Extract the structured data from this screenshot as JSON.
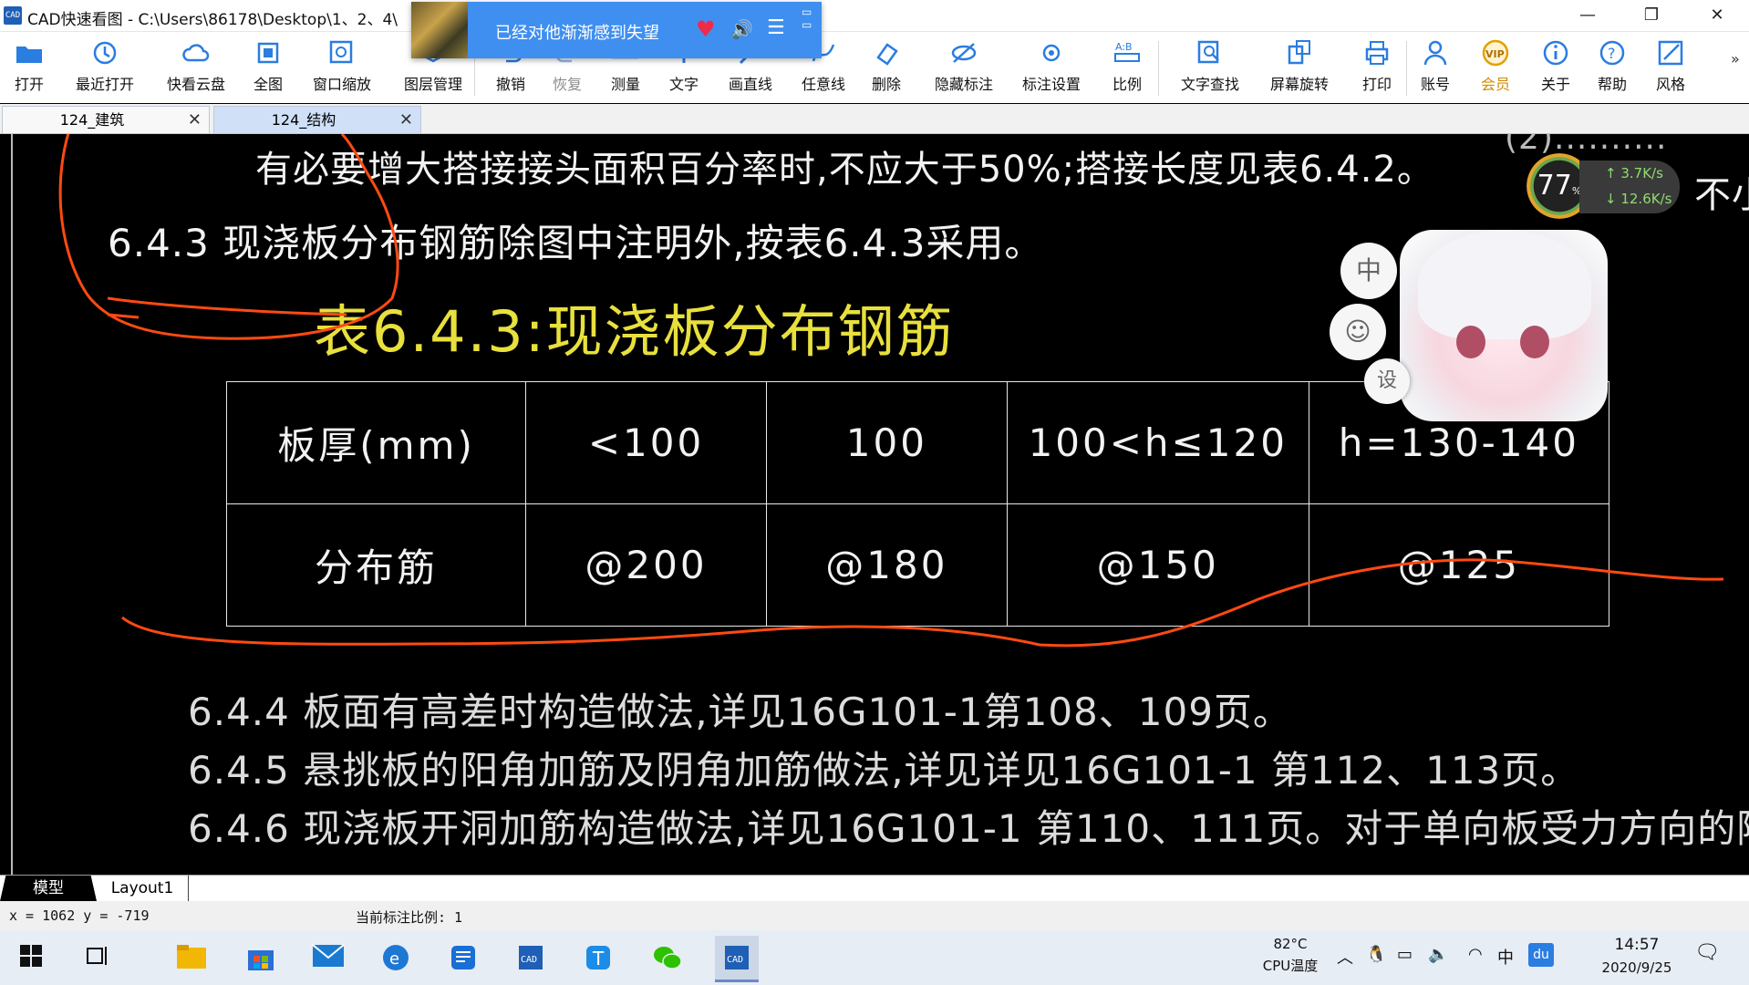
{
  "window": {
    "app_icon": "CAD",
    "title": "CAD快速看图 - C:\\Users\\86178\\Desktop\\1、2、4\\",
    "controls": [
      "minimize-icon",
      "restore-icon",
      "close-icon"
    ]
  },
  "music_popup": {
    "text": "已经对他渐渐感到失望"
  },
  "toolbar": {
    "items": [
      {
        "label": "打开",
        "icon": "folder-open-icon"
      },
      {
        "label": "最近打开",
        "icon": "history-icon"
      },
      {
        "label": "快看云盘",
        "icon": "cloud-icon"
      },
      {
        "label": "全图",
        "icon": "fit-all-icon"
      },
      {
        "label": "窗口缩放",
        "icon": "zoom-window-icon"
      },
      {
        "label": "图层管理",
        "icon": "layers-icon"
      },
      {
        "label": "撤销",
        "icon": "undo-icon"
      },
      {
        "label": "恢复",
        "icon": "redo-icon",
        "disabled": true
      },
      {
        "label": "测量",
        "icon": "measure-icon"
      },
      {
        "label": "文字",
        "icon": "text-icon"
      },
      {
        "label": "画直线",
        "icon": "line-icon"
      },
      {
        "label": "任意线",
        "icon": "freehand-icon"
      },
      {
        "label": "删除",
        "icon": "eraser-icon"
      },
      {
        "label": "隐藏标注",
        "icon": "hide-icon"
      },
      {
        "label": "标注设置",
        "icon": "annotation-settings-icon"
      },
      {
        "label": "比例",
        "icon": "scale-icon"
      },
      {
        "label": "文字查找",
        "icon": "text-search-icon"
      },
      {
        "label": "屏幕旋转",
        "icon": "rotate-icon"
      },
      {
        "label": "打印",
        "icon": "print-icon"
      },
      {
        "label": "账号",
        "icon": "user-icon"
      },
      {
        "label": "会员",
        "icon": "vip-icon"
      },
      {
        "label": "关于",
        "icon": "info-icon"
      },
      {
        "label": "帮助",
        "icon": "help-icon"
      },
      {
        "label": "风格",
        "icon": "style-icon"
      }
    ],
    "vip_badge": "VIP"
  },
  "tabs": [
    {
      "label": "124_建筑",
      "active": false
    },
    {
      "label": "124_结构",
      "active": true
    }
  ],
  "drawing": {
    "line1": "有必要增大搭接接头面积百分率时,不应大于50%;搭接长度见表6.4.2。",
    "line2": "6.4.3  现浇板分布钢筋除图中注明外,按表6.4.3采用。",
    "table_title": "表6.4.3:现浇板分布钢筋",
    "table": {
      "rows": [
        [
          "板厚(mm)",
          "<100",
          "100",
          "100<h≤120",
          "h=130-140"
        ],
        [
          "分布筋",
          "@200",
          "@180",
          "@150",
          "@125"
        ]
      ]
    },
    "line3": "6.4.4  板面有高差时构造做法,详见16G101-1第108、109页。",
    "line4": "6.4.5  悬挑板的阳角加筋及阴角加筋做法,详见详见16G101-1  第112、113页。",
    "line5": "6.4.6  现浇板开洞加筋构造做法,详见16G101-1  第110、111页。对于单向板受力方向的附加钢筋应伸",
    "right_partial_top": "(2)..........",
    "right_partial": "不小"
  },
  "overlays": {
    "perf_percent": "77",
    "perf_unit": "%",
    "upload": "3.7K/s",
    "download": "12.6K/s",
    "bubble_top": "中",
    "bubble_bottom": "设"
  },
  "layout_tabs": [
    "模型",
    "Layout1"
  ],
  "status": {
    "coords": "x = 1062  y = -719",
    "scale": "当前标注比例: 1"
  },
  "taskbar": {
    "cpu_temp": "82°C",
    "cpu_label": "CPU温度",
    "ime": "中",
    "time": "14:57",
    "date": "2020/9/25"
  },
  "colors": {
    "canvas_bg": "#000000",
    "table_title": "#e8e03c",
    "markup": "#ff4a12",
    "popup": "#3f8ff0"
  }
}
